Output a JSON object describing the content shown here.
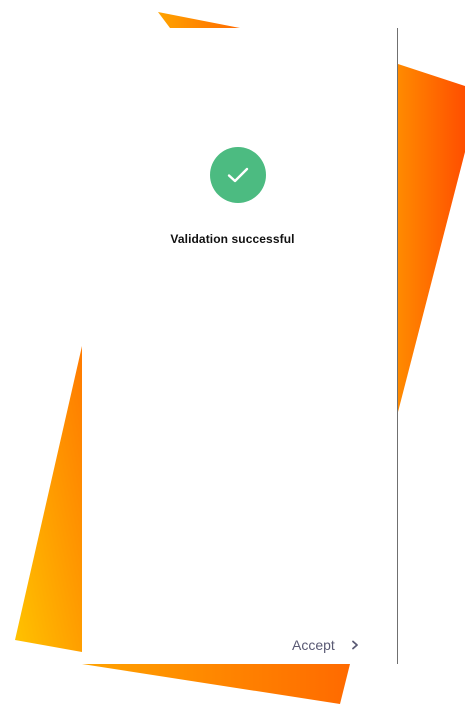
{
  "colors": {
    "accent_orange": "#ff5a00",
    "accent_yellow": "#ffc300",
    "success_green": "#4cbb81",
    "text_dark": "#111111",
    "accept_text": "#5a5a74"
  },
  "icons": {
    "success": "check-icon",
    "action": "chevron-right-icon"
  },
  "main": {
    "title": "Validation successful"
  },
  "actions": {
    "accept_label": "Accept"
  }
}
